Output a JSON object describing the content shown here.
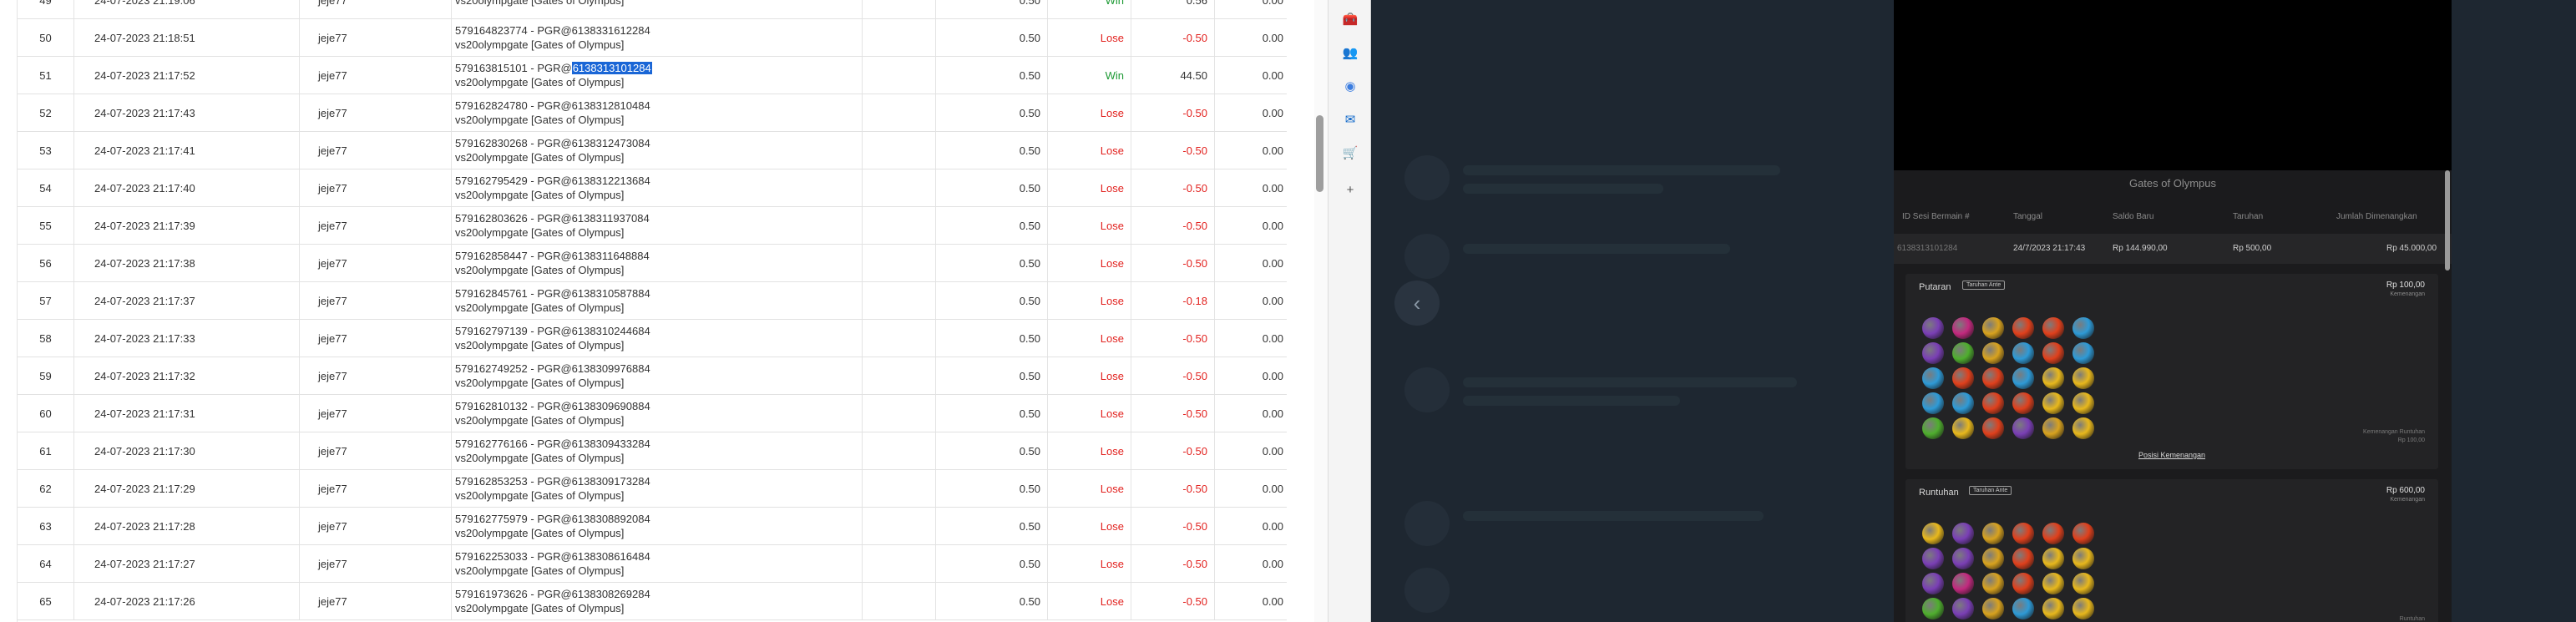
{
  "table": {
    "rows": [
      {
        "no": "49",
        "date": "24-07-2023 21:19:06",
        "user": "jeje77",
        "ref": "",
        "game": "vs20olympgate [Gates of Olympus]",
        "bet": "0.50",
        "result": "Win",
        "amount": "0.56",
        "balance": "0.00"
      },
      {
        "no": "50",
        "date": "24-07-2023 21:18:51",
        "user": "jeje77",
        "ref": "579164823774 - PGR@6138331612284",
        "game": "vs20olympgate [Gates of Olympus]",
        "bet": "0.50",
        "result": "Lose",
        "amount": "-0.50",
        "balance": "0.00"
      },
      {
        "no": "51",
        "date": "24-07-2023 21:17:52",
        "user": "jeje77",
        "ref": "579163815101 - PGR@",
        "ref_highlight": "6138313101284",
        "game": "vs20olympgate [Gates of Olympus]",
        "bet": "0.50",
        "result": "Win",
        "amount": "44.50",
        "balance": "0.00"
      },
      {
        "no": "52",
        "date": "24-07-2023 21:17:43",
        "user": "jeje77",
        "ref": "579162824780 - PGR@6138312810484",
        "game": "vs20olympgate [Gates of Olympus]",
        "bet": "0.50",
        "result": "Lose",
        "amount": "-0.50",
        "balance": "0.00"
      },
      {
        "no": "53",
        "date": "24-07-2023 21:17:41",
        "user": "jeje77",
        "ref": "579162830268 - PGR@6138312473084",
        "game": "vs20olympgate [Gates of Olympus]",
        "bet": "0.50",
        "result": "Lose",
        "amount": "-0.50",
        "balance": "0.00"
      },
      {
        "no": "54",
        "date": "24-07-2023 21:17:40",
        "user": "jeje77",
        "ref": "579162795429 - PGR@6138312213684",
        "game": "vs20olympgate [Gates of Olympus]",
        "bet": "0.50",
        "result": "Lose",
        "amount": "-0.50",
        "balance": "0.00"
      },
      {
        "no": "55",
        "date": "24-07-2023 21:17:39",
        "user": "jeje77",
        "ref": "579162803626 - PGR@6138311937084",
        "game": "vs20olympgate [Gates of Olympus]",
        "bet": "0.50",
        "result": "Lose",
        "amount": "-0.50",
        "balance": "0.00"
      },
      {
        "no": "56",
        "date": "24-07-2023 21:17:38",
        "user": "jeje77",
        "ref": "579162858447 - PGR@6138311648884",
        "game": "vs20olympgate [Gates of Olympus]",
        "bet": "0.50",
        "result": "Lose",
        "amount": "-0.50",
        "balance": "0.00"
      },
      {
        "no": "57",
        "date": "24-07-2023 21:17:37",
        "user": "jeje77",
        "ref": "579162845761 - PGR@6138310587884",
        "game": "vs20olympgate [Gates of Olympus]",
        "bet": "0.50",
        "result": "Lose",
        "amount": "-0.18",
        "balance": "0.00"
      },
      {
        "no": "58",
        "date": "24-07-2023 21:17:33",
        "user": "jeje77",
        "ref": "579162797139 - PGR@6138310244684",
        "game": "vs20olympgate [Gates of Olympus]",
        "bet": "0.50",
        "result": "Lose",
        "amount": "-0.50",
        "balance": "0.00"
      },
      {
        "no": "59",
        "date": "24-07-2023 21:17:32",
        "user": "jeje77",
        "ref": "579162749252 - PGR@6138309976884",
        "game": "vs20olympgate [Gates of Olympus]",
        "bet": "0.50",
        "result": "Lose",
        "amount": "-0.50",
        "balance": "0.00"
      },
      {
        "no": "60",
        "date": "24-07-2023 21:17:31",
        "user": "jeje77",
        "ref": "579162810132 - PGR@6138309690884",
        "game": "vs20olympgate [Gates of Olympus]",
        "bet": "0.50",
        "result": "Lose",
        "amount": "-0.50",
        "balance": "0.00"
      },
      {
        "no": "61",
        "date": "24-07-2023 21:17:30",
        "user": "jeje77",
        "ref": "579162776166 - PGR@6138309433284",
        "game": "vs20olympgate [Gates of Olympus]",
        "bet": "0.50",
        "result": "Lose",
        "amount": "-0.50",
        "balance": "0.00"
      },
      {
        "no": "62",
        "date": "24-07-2023 21:17:29",
        "user": "jeje77",
        "ref": "579162853253 - PGR@6138309173284",
        "game": "vs20olympgate [Gates of Olympus]",
        "bet": "0.50",
        "result": "Lose",
        "amount": "-0.50",
        "balance": "0.00"
      },
      {
        "no": "63",
        "date": "24-07-2023 21:17:28",
        "user": "jeje77",
        "ref": "579162775979 - PGR@6138308892084",
        "game": "vs20olympgate [Gates of Olympus]",
        "bet": "0.50",
        "result": "Lose",
        "amount": "-0.50",
        "balance": "0.00"
      },
      {
        "no": "64",
        "date": "24-07-2023 21:17:27",
        "user": "jeje77",
        "ref": "579162253033 - PGR@6138308616484",
        "game": "vs20olympgate [Gates of Olympus]",
        "bet": "0.50",
        "result": "Lose",
        "amount": "-0.50",
        "balance": "0.00"
      },
      {
        "no": "65",
        "date": "24-07-2023 21:17:26",
        "user": "jeje77",
        "ref": "579161973626 - PGR@6138308269284",
        "game": "vs20olympgate [Gates of Olympus]",
        "bet": "0.50",
        "result": "Lose",
        "amount": "-0.50",
        "balance": "0.00"
      }
    ]
  },
  "sidebar": {
    "items": [
      {
        "name": "toolbox-icon",
        "glyph": "🧰",
        "color": "#d04a2a"
      },
      {
        "name": "teams-icon",
        "glyph": "👥",
        "color": "#6264a7"
      },
      {
        "name": "copilot-icon",
        "glyph": "◉",
        "color": "#3b7de0"
      },
      {
        "name": "outlook-icon",
        "glyph": "✉",
        "color": "#0a64c8"
      },
      {
        "name": "shopping-icon",
        "glyph": "🛒",
        "color": "#1a7fd4"
      },
      {
        "name": "add-icon",
        "glyph": "+",
        "color": "#555555"
      }
    ]
  },
  "game": {
    "back_glyph": "‹",
    "history": {
      "title": "Gates of Olympus",
      "headers": [
        "ID Sesi Bermain #",
        "Tanggal",
        "Saldo Baru",
        "Taruhan",
        "Jumlah Dimenangkan"
      ],
      "row": [
        "6138313101284",
        "24/7/2023 21:17:43",
        "Rp 144.990,00",
        "Rp 500,00",
        "Rp 45.000,00"
      ]
    },
    "sections": [
      {
        "title": "Putaran",
        "tag": "Taruhan Ante",
        "amount": "Rp 100,00",
        "sub": "Kemenangan",
        "foot1": "Kemenangan Runtuhan",
        "foot2": "Rp 100,00",
        "link": "Posisi Kemenangan"
      },
      {
        "title": "Runtuhan",
        "tag": "Taruhan Ante",
        "amount": "Rp 600,00",
        "sub": "Kemenangan",
        "foot1": "Runtuhan",
        "foot2": ""
      }
    ],
    "grid1": [
      [
        "#7a3fb5",
        "#c2297e",
        "#d8a21e",
        "#e0401c",
        "#e0401c",
        "#2e9ad6"
      ],
      [
        "#7a3fb5",
        "#4fae2e",
        "#d8a21e",
        "#2e9ad6",
        "#e0401c",
        "#2e9ad6"
      ],
      [
        "#2e9ad6",
        "#e0401c",
        "#e0401c",
        "#2e9ad6",
        "#e8b81c",
        "#e8b81c"
      ],
      [
        "#2e9ad6",
        "#2e9ad6",
        "#e0401c",
        "#e0401c",
        "#e8b81c",
        "#e8b81c"
      ],
      [
        "#4fae2e",
        "#e8b81c",
        "#e0401c",
        "#7a3fb5",
        "#d8a21e",
        "#e8b81c"
      ]
    ],
    "grid2": [
      [
        "#e8b81c",
        "#7a3fb5",
        "#d8a21e",
        "#e0401c",
        "#e0401c",
        "#e0401c"
      ],
      [
        "#7a3fb5",
        "#7a3fb5",
        "#d8a21e",
        "#e0401c",
        "#e8b81c",
        "#e8b81c"
      ],
      [
        "#7a3fb5",
        "#c2297e",
        "#d8a21e",
        "#e0401c",
        "#e8b81c",
        "#e8b81c"
      ],
      [
        "#4fae2e",
        "#7a3fb5",
        "#d8a21e",
        "#2e9ad6",
        "#e8b81c",
        "#e8b81c"
      ],
      [
        "#2e9ad6",
        "#4fae2e",
        "#e0401c",
        "#e0401c",
        "#e8b81c",
        "#e8b81c"
      ]
    ]
  }
}
